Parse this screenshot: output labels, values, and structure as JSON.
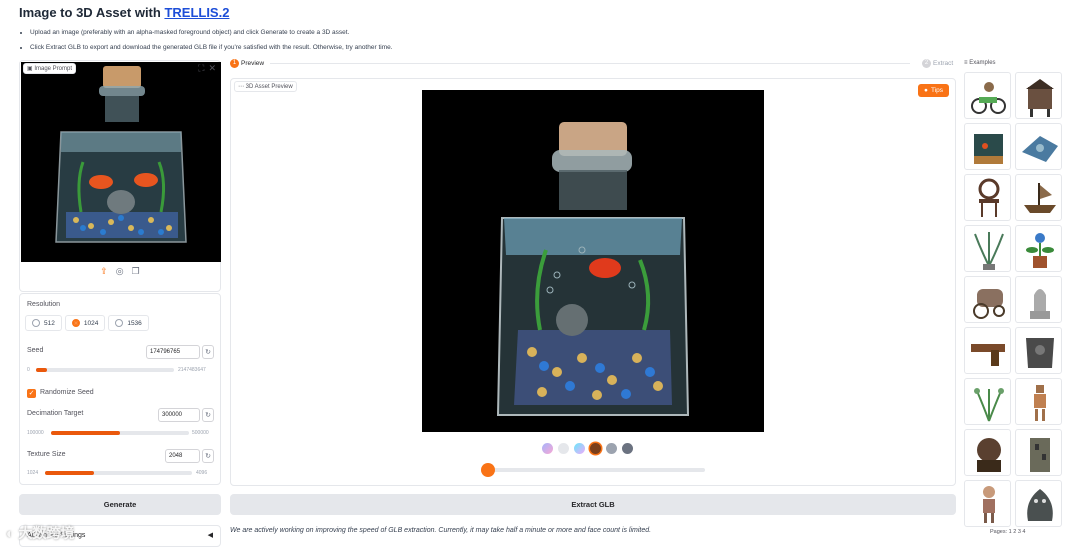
{
  "header": {
    "title_prefix": "Image to 3D Asset with ",
    "title_link": "TRELLIS.2",
    "instructions": [
      "Upload an image (preferably with an alpha-masked foreground object) and click Generate to create a 3D asset.",
      "Click Extract GLB to export and download the generated GLB file if you're satisfied with the result. Otherwise, try another time."
    ]
  },
  "image_panel": {
    "label": "Image Prompt"
  },
  "settings": {
    "resolution": {
      "label": "Resolution",
      "options": [
        "512",
        "1024",
        "1536"
      ],
      "selected": "1024"
    },
    "seed": {
      "label": "Seed",
      "value": "174796765",
      "min": "0",
      "max": "2147483647",
      "fraction": 0.08
    },
    "randomize_label": "Randomize Seed",
    "randomize_checked": true,
    "decimation": {
      "label": "Decimation Target",
      "value": "300000",
      "min": "100000",
      "max": "500000",
      "fraction": 0.5
    },
    "texture": {
      "label": "Texture Size",
      "value": "2048",
      "min": "1024",
      "max": "4096",
      "fraction": 0.33
    }
  },
  "buttons": {
    "generate": "Generate",
    "extract": "Extract GLB"
  },
  "advanced": {
    "label": "Advanced Settings"
  },
  "steps": [
    {
      "num": "1",
      "label": "Preview"
    },
    {
      "num": "2",
      "label": "Extract"
    }
  ],
  "preview": {
    "label": "3D Asset Preview",
    "tips": "Tips",
    "slider_fraction": 0.0
  },
  "note": "We are actively working on improving the speed of GLB extraction. Currently, it may take half a minute or more and face count is limited.",
  "examples": {
    "label": "Examples",
    "pages": "Pages: 1 2 3 4",
    "items": [
      "motorcycle-rider",
      "house-on-legs",
      "fish-tank",
      "spaceship",
      "metal-chair",
      "pirate-ship",
      "grass-plant",
      "blue-flower-pot",
      "wagon",
      "stone-statue",
      "pistol",
      "armor",
      "vine-plant",
      "robot-figure",
      "monkey-bust",
      "stone-tower",
      "girl-figure",
      "rock-creature"
    ]
  },
  "colors": {
    "accent": "#f97316",
    "link": "#1d4ed8"
  }
}
